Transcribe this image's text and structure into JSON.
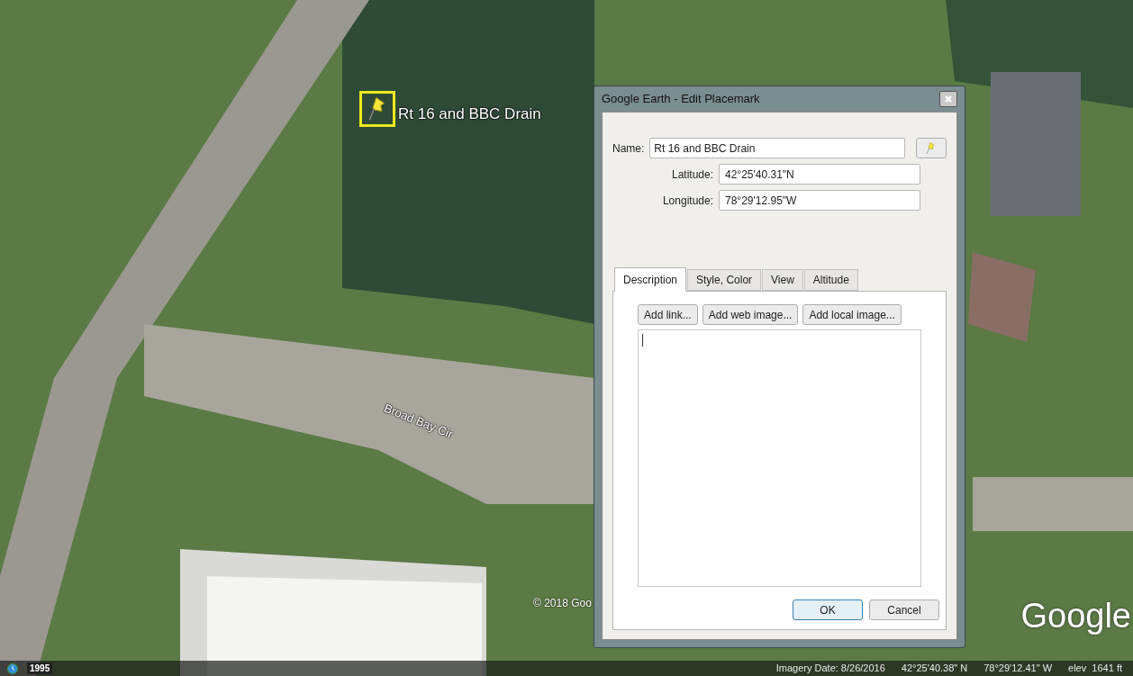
{
  "map": {
    "placemark_label": "Rt 16 and BBC Drain",
    "road_label": "Broad Bay Cir",
    "copyright": "© 2018 Goo",
    "logo": "Google",
    "history_year": "1995"
  },
  "dialog": {
    "title": "Google Earth - Edit Placemark",
    "name_field": {
      "label": "Name:",
      "value": "Rt 16 and BBC Drain"
    },
    "coordinates": [
      {
        "label": "Latitude:",
        "value": "42°25'40.31\"N"
      },
      {
        "label": "Longitude:",
        "value": "78°29'12.95\"W"
      }
    ],
    "tabs": [
      {
        "label": "Description",
        "selected": true
      },
      {
        "label": "Style, Color",
        "selected": false
      },
      {
        "label": "View",
        "selected": false
      },
      {
        "label": "Altitude",
        "selected": false
      }
    ],
    "description_buttons": [
      "Add link...",
      "Add web image...",
      "Add local image..."
    ],
    "buttons": [
      {
        "label": "OK",
        "default": true
      },
      {
        "label": "Cancel",
        "default": false
      }
    ]
  },
  "status_bar": {
    "imagery_date": "Imagery Date: 8/26/2016",
    "latitude": "42°25'40.38\" N",
    "longitude": "78°29'12.41\" W",
    "elevation": "elev  1641 ft"
  }
}
